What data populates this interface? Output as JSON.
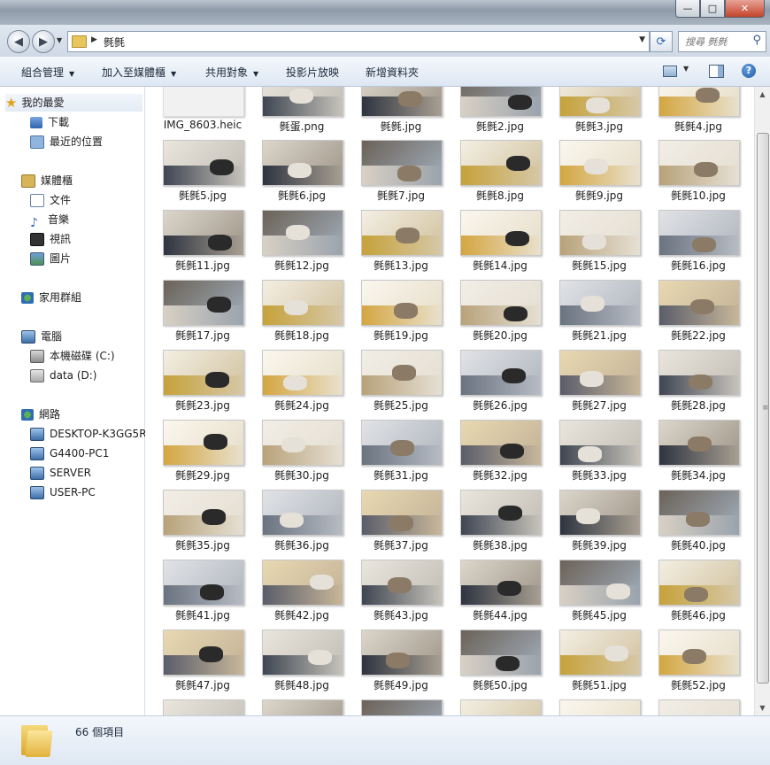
{
  "window": {
    "minimize": "—",
    "maximize": "□",
    "close": "✕"
  },
  "address": {
    "path": "毿毿",
    "search_placeholder": "搜尋 毿毿"
  },
  "toolbar": {
    "organize": "組合管理",
    "add_to_library": "加入至媒體櫃",
    "share_with": "共用對象",
    "slideshow": "投影片放映",
    "new_folder": "新增資料夾",
    "help": "?"
  },
  "nav": {
    "favorites": "我的最愛",
    "downloads": "下載",
    "recent": "最近的位置",
    "libraries": "媒體櫃",
    "documents": "文件",
    "music": "音樂",
    "videos": "視訊",
    "pictures": "圖片",
    "homegroup": "家用群組",
    "computer": "電腦",
    "drive_c": "本機磁碟 (C:)",
    "drive_d": "data (D:)",
    "network": "網路",
    "host1": "DESKTOP-K3GG5R",
    "host2": "G4400-PC1",
    "host3": "SERVER",
    "host4": "USER-PC"
  },
  "files": [
    "IMG_8603.heic",
    "毿蛋.png",
    "毿毿.jpg",
    "毿毿2.jpg",
    "毿毿3.jpg",
    "毿毿4.jpg",
    "毿毿5.jpg",
    "毿毿6.jpg",
    "毿毿7.jpg",
    "毿毿8.jpg",
    "毿毿9.jpg",
    "毿毿10.jpg",
    "毿毿11.jpg",
    "毿毿12.jpg",
    "毿毿13.jpg",
    "毿毿14.jpg",
    "毿毿15.jpg",
    "毿毿16.jpg",
    "毿毿17.jpg",
    "毿毿18.jpg",
    "毿毿19.jpg",
    "毿毿20.jpg",
    "毿毿21.jpg",
    "毿毿22.jpg",
    "毿毿23.jpg",
    "毿毿24.jpg",
    "毿毿25.jpg",
    "毿毿26.jpg",
    "毿毿27.jpg",
    "毿毿28.jpg",
    "毿毿29.jpg",
    "毿毿30.jpg",
    "毿毿31.jpg",
    "毿毿32.jpg",
    "毿毿33.jpg",
    "毿毿34.jpg",
    "毿毿35.jpg",
    "毿毿36.jpg",
    "毿毿37.jpg",
    "毿毿38.jpg",
    "毿毿39.jpg",
    "毿毿40.jpg",
    "毿毿41.jpg",
    "毿毿42.jpg",
    "毿毿43.jpg",
    "毿毿44.jpg",
    "毿毿45.jpg",
    "毿毿46.jpg",
    "毿毿47.jpg",
    "毿毿48.jpg",
    "毿毿49.jpg",
    "毿毿50.jpg",
    "毿毿51.jpg",
    "毿毿52.jpg"
  ],
  "status": {
    "count": "66 個項目"
  }
}
